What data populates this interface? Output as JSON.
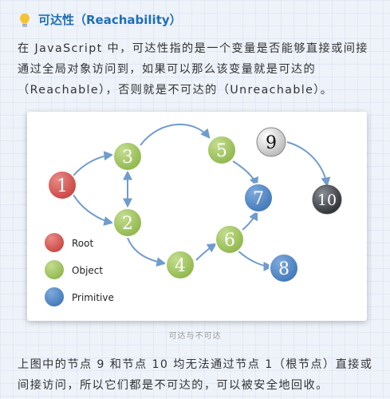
{
  "heading": {
    "text": "可达性（Reachability）"
  },
  "para1": "在 JavaScript 中，可达性指的是一个变量是否能够直接或间接通过全局对象访问到，如果可以那么该变量就是可达的（Reachable），否则就是不可达的（Unreachable）。",
  "figure": {
    "nodes": [
      {
        "label": "1",
        "kind": "root"
      },
      {
        "label": "2",
        "kind": "object"
      },
      {
        "label": "3",
        "kind": "object"
      },
      {
        "label": "4",
        "kind": "object"
      },
      {
        "label": "5",
        "kind": "object"
      },
      {
        "label": "6",
        "kind": "object"
      },
      {
        "label": "7",
        "kind": "primitive"
      },
      {
        "label": "8",
        "kind": "primitive"
      },
      {
        "label": "9",
        "kind": "unreachable-light"
      },
      {
        "label": "10",
        "kind": "unreachable-dark"
      }
    ],
    "legend": [
      {
        "label": "Root",
        "kind": "root"
      },
      {
        "label": "Object",
        "kind": "object"
      },
      {
        "label": "Primitive",
        "kind": "primitive"
      }
    ],
    "colors": {
      "root": "#d0524f",
      "object": "#9cc25a",
      "primitive": "#4f86c4",
      "edge": "#6f9ccc"
    }
  },
  "caption": "可达与不可达",
  "para2": "上图中的节点 9 和节点 10 均无法通过节点 1（根节点）直接或间接访问，所以它们都是不可达的，可以被安全地回收。"
}
